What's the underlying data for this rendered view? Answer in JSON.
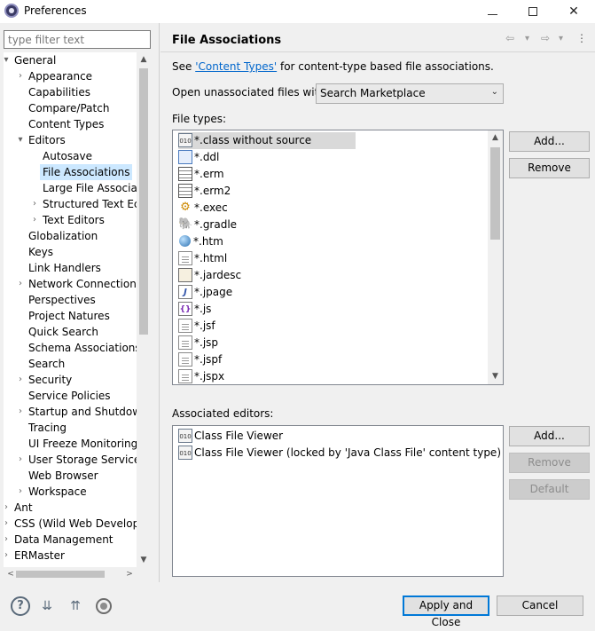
{
  "window": {
    "title": "Preferences",
    "minimize_glyph": "",
    "maximize_glyph": "",
    "close_glyph": "✕"
  },
  "filter": {
    "placeholder": "type filter text"
  },
  "tree": {
    "items": [
      {
        "label": "General",
        "twisty": "▾"
      },
      {
        "label": "Appearance",
        "twisty": "›"
      },
      {
        "label": "Capabilities",
        "twisty": ""
      },
      {
        "label": "Compare/Patch",
        "twisty": ""
      },
      {
        "label": "Content Types",
        "twisty": ""
      },
      {
        "label": "Editors",
        "twisty": "▾"
      },
      {
        "label": "Autosave",
        "twisty": ""
      },
      {
        "label": "File Associations",
        "twisty": ""
      },
      {
        "label": "Large File Associa",
        "twisty": ""
      },
      {
        "label": "Structured Text Ec",
        "twisty": "›"
      },
      {
        "label": "Text Editors",
        "twisty": "›"
      },
      {
        "label": "Globalization",
        "twisty": ""
      },
      {
        "label": "Keys",
        "twisty": ""
      },
      {
        "label": "Link Handlers",
        "twisty": ""
      },
      {
        "label": "Network Connection",
        "twisty": "›"
      },
      {
        "label": "Perspectives",
        "twisty": ""
      },
      {
        "label": "Project Natures",
        "twisty": ""
      },
      {
        "label": "Quick Search",
        "twisty": ""
      },
      {
        "label": "Schema Associations",
        "twisty": ""
      },
      {
        "label": "Search",
        "twisty": ""
      },
      {
        "label": "Security",
        "twisty": "›"
      },
      {
        "label": "Service Policies",
        "twisty": ""
      },
      {
        "label": "Startup and Shutdow",
        "twisty": "›"
      },
      {
        "label": "Tracing",
        "twisty": ""
      },
      {
        "label": "UI Freeze Monitoring",
        "twisty": ""
      },
      {
        "label": "User Storage Service",
        "twisty": "›"
      },
      {
        "label": "Web Browser",
        "twisty": ""
      },
      {
        "label": "Workspace",
        "twisty": "›"
      },
      {
        "label": "Ant",
        "twisty": "›"
      },
      {
        "label": "CSS (Wild Web Develop",
        "twisty": "›"
      },
      {
        "label": "Data Management",
        "twisty": "›"
      },
      {
        "label": "ERMaster",
        "twisty": "›"
      }
    ],
    "selected": "File Associations",
    "scroll_up": "▲",
    "scroll_down": "▼",
    "scroll_left": "<",
    "scroll_right": ">"
  },
  "page": {
    "title": "File Associations",
    "nav_back": "⇦",
    "nav_back_menu": "▾",
    "nav_forward": "⇨",
    "nav_forward_menu": "▾",
    "nav_more": "⋮",
    "see_prefix": "See ",
    "see_link": "'Content Types'",
    "see_suffix": " for content-type based file associations.",
    "open_label": "Open unassociated files with:",
    "open_value": "Search Marketplace",
    "open_chevron": "⌄",
    "file_types_label": "File types:",
    "file_types": [
      {
        "icon": "class-file-icon",
        "glyph": "010",
        "label": "*.class without source"
      },
      {
        "icon": "ddl-file-icon",
        "glyph": "",
        "label": "*.ddl"
      },
      {
        "icon": "erm-file-icon",
        "glyph": "",
        "label": "*.erm"
      },
      {
        "icon": "erm-file-icon",
        "glyph": "",
        "label": "*.erm2"
      },
      {
        "icon": "exec-file-icon",
        "glyph": "⚙",
        "label": "*.exec"
      },
      {
        "icon": "gradle-file-icon",
        "glyph": "🐘",
        "label": "*.gradle"
      },
      {
        "icon": "htm-file-icon",
        "glyph": "",
        "label": "*.htm"
      },
      {
        "icon": "html-file-icon",
        "glyph": "",
        "label": "*.html"
      },
      {
        "icon": "jardesc-file-icon",
        "glyph": "",
        "label": "*.jardesc"
      },
      {
        "icon": "jpage-file-icon",
        "glyph": "J",
        "label": "*.jpage"
      },
      {
        "icon": "js-file-icon",
        "glyph": "{}",
        "label": "*.js"
      },
      {
        "icon": "jsf-file-icon",
        "glyph": "",
        "label": "*.jsf"
      },
      {
        "icon": "jsp-file-icon",
        "glyph": "",
        "label": "*.jsp"
      },
      {
        "icon": "jspf-file-icon",
        "glyph": "",
        "label": "*.jspf"
      },
      {
        "icon": "jspx-file-icon",
        "glyph": "",
        "label": "*.jspx"
      }
    ],
    "file_types_selected": "*.class without source",
    "file_types_buttons": {
      "add": "Add...",
      "remove": "Remove"
    },
    "assoc_label": "Associated editors:",
    "assoc_editors": [
      {
        "icon": "class-file-icon",
        "glyph": "010",
        "label": "Class File Viewer"
      },
      {
        "icon": "class-file-icon",
        "glyph": "010",
        "label": "Class File Viewer (locked by 'Java Class File' content type)"
      }
    ],
    "assoc_buttons": {
      "add": "Add...",
      "remove": "Remove",
      "default": "Default"
    },
    "list_scroll_up": "▲",
    "list_scroll_down": "▼"
  },
  "footer": {
    "help_glyph": "?",
    "import_glyph": "⇊",
    "export_glyph": "⇈",
    "apply_close": "Apply and Close",
    "cancel": "Cancel"
  }
}
